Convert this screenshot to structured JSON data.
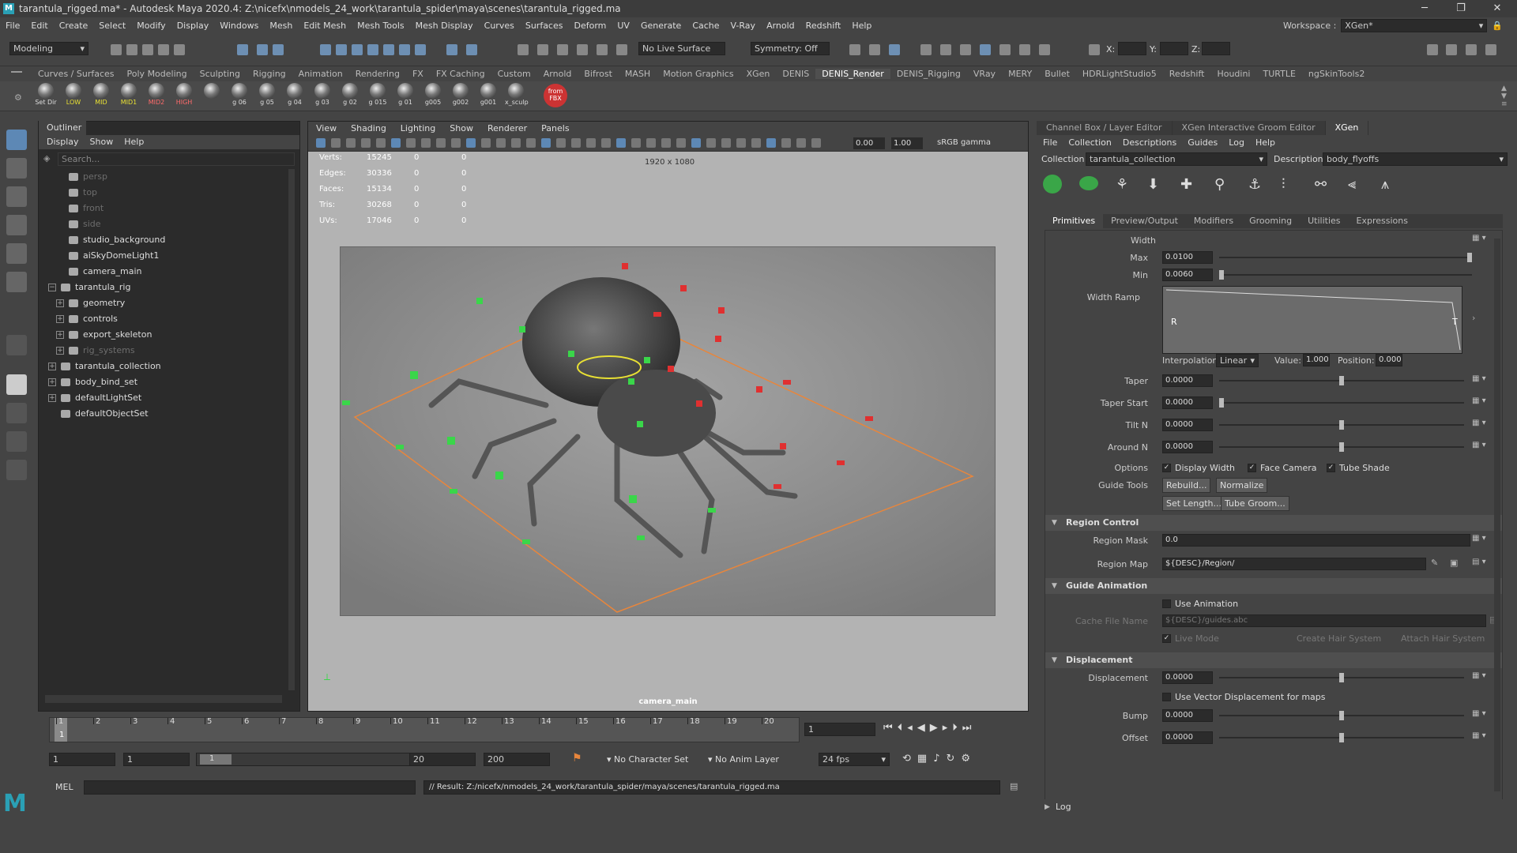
{
  "window": {
    "title": "tarantula_rigged.ma* - Autodesk Maya 2020.4: Z:\\nicefx\\nmodels_24_work\\tarantula_spider\\maya\\scenes\\tarantula_rigged.ma",
    "minimize": "─",
    "maximize": "❐",
    "close": "✕"
  },
  "menubar": {
    "items": [
      "File",
      "Edit",
      "Create",
      "Select",
      "Modify",
      "Display",
      "Windows",
      "Mesh",
      "Edit Mesh",
      "Mesh Tools",
      "Mesh Display",
      "Curves",
      "Surfaces",
      "Deform",
      "UV",
      "Generate",
      "Cache",
      "V-Ray",
      "Arnold",
      "Redshift",
      "Help"
    ],
    "workspace_label": "Workspace :",
    "workspace_value": "XGen*"
  },
  "statusline": {
    "mode": "Modeling",
    "live_surface": "No Live Surface",
    "symmetry": "Symmetry: Off",
    "x_label": "X:",
    "y_label": "Y:",
    "z_label": "Z:"
  },
  "shelf": {
    "tabs": [
      "Curves / Surfaces",
      "Poly Modeling",
      "Sculpting",
      "Rigging",
      "Animation",
      "Rendering",
      "FX",
      "FX Caching",
      "Custom",
      "Arnold",
      "Bifrost",
      "MASH",
      "Motion Graphics",
      "XGen",
      "DENIS",
      "DENIS_Render",
      "DENIS_Rigging",
      "VRay",
      "MERY",
      "Bullet",
      "HDRLightStudio5",
      "Redshift",
      "Houdini",
      "TURTLE",
      "ngSkinTools2"
    ],
    "active_tab": "DENIS_Render",
    "buttons": [
      "Set Dir",
      "LOW",
      "MID",
      "MID1",
      "MID2",
      "HIGH",
      "",
      "g 06",
      "g 05",
      "g 04",
      "g 03",
      "g 02",
      "g 015",
      "g 01",
      "g005",
      "g002",
      "g001",
      "x_sculp",
      ""
    ],
    "fbx_label": "from FBX"
  },
  "outliner": {
    "title": "Outliner",
    "menu": [
      "Display",
      "Show",
      "Help"
    ],
    "search_placeholder": "Search...",
    "items": [
      {
        "label": "persp",
        "indent": 1,
        "dim": true,
        "exp": ""
      },
      {
        "label": "top",
        "indent": 1,
        "dim": true,
        "exp": ""
      },
      {
        "label": "front",
        "indent": 1,
        "dim": true,
        "exp": ""
      },
      {
        "label": "side",
        "indent": 1,
        "dim": true,
        "exp": ""
      },
      {
        "label": "studio_background",
        "indent": 1,
        "dim": false,
        "exp": ""
      },
      {
        "label": "aiSkyDomeLight1",
        "indent": 1,
        "dim": false,
        "exp": ""
      },
      {
        "label": "camera_main",
        "indent": 1,
        "dim": false,
        "exp": ""
      },
      {
        "label": "tarantula_rig",
        "indent": 0,
        "dim": false,
        "exp": "−"
      },
      {
        "label": "geometry",
        "indent": 1,
        "dim": false,
        "exp": "+"
      },
      {
        "label": "controls",
        "indent": 1,
        "dim": false,
        "exp": "+"
      },
      {
        "label": "export_skeleton",
        "indent": 1,
        "dim": false,
        "exp": "+"
      },
      {
        "label": "rig_systems",
        "indent": 1,
        "dim": true,
        "exp": "+"
      },
      {
        "label": "tarantula_collection",
        "indent": 0,
        "dim": false,
        "exp": "+"
      },
      {
        "label": "body_bind_set",
        "indent": 0,
        "dim": false,
        "exp": "+"
      },
      {
        "label": "defaultLightSet",
        "indent": 0,
        "dim": false,
        "exp": "+"
      },
      {
        "label": "defaultObjectSet",
        "indent": 0,
        "dim": false,
        "exp": ""
      }
    ]
  },
  "viewport": {
    "menu": [
      "View",
      "Shading",
      "Lighting",
      "Show",
      "Renderer",
      "Panels"
    ],
    "field1": "0.00",
    "field2": "1.00",
    "colorspace": "sRGB gamma",
    "hud": [
      {
        "label": "Verts:",
        "v1": "15245",
        "v2": "0",
        "v3": "0"
      },
      {
        "label": "Edges:",
        "v1": "30336",
        "v2": "0",
        "v3": "0"
      },
      {
        "label": "Faces:",
        "v1": "15134",
        "v2": "0",
        "v3": "0"
      },
      {
        "label": "Tris:",
        "v1": "30268",
        "v2": "0",
        "v3": "0"
      },
      {
        "label": "UVs:",
        "v1": "17046",
        "v2": "0",
        "v3": "0"
      }
    ],
    "resolution": "1920 x 1080",
    "camera": "camera_main"
  },
  "rpanel": {
    "tabs": [
      "Channel Box / Layer Editor",
      "XGen Interactive Groom Editor",
      "XGen"
    ],
    "active_tab": "XGen",
    "menu": [
      "File",
      "Collection",
      "Descriptions",
      "Guides",
      "Log",
      "Help"
    ],
    "collection_label": "Collection",
    "collection_value": "tarantula_collection",
    "description_label": "Description",
    "description_value": "body_flyoffs",
    "subtabs": [
      "Primitives",
      "Preview/Output",
      "Modifiers",
      "Grooming",
      "Utilities",
      "Expressions"
    ],
    "active_subtab": "Primitives",
    "width_label": "Width",
    "max_label": "Max",
    "max_value": "0.0100",
    "min_label": "Min",
    "min_value": "0.0060",
    "ramp_label": "Width Ramp",
    "ramp_r": "R",
    "ramp_t": "T",
    "interp_label": "Interpolation:",
    "interp_value": "Linear",
    "value_label": "Value:",
    "value_value": "1.000",
    "position_label": "Position:",
    "position_value": "0.000",
    "taper_label": "Taper",
    "taper_value": "0.0000",
    "taper_start_label": "Taper Start",
    "taper_start_value": "0.0000",
    "tilt_label": "Tilt N",
    "tilt_value": "0.0000",
    "around_label": "Around N",
    "around_value": "0.0000",
    "options_label": "Options",
    "opt_display_width": "Display Width",
    "opt_face_camera": "Face Camera",
    "opt_tube_shade": "Tube Shade",
    "guide_tools_label": "Guide Tools",
    "btn_rebuild": "Rebuild...",
    "btn_normalize": "Normalize",
    "btn_set_length": "Set Length...",
    "btn_tube_groom": "Tube Groom...",
    "sec_region": "Region Control",
    "region_mask_label": "Region Mask",
    "region_mask_value": "0.0",
    "region_map_label": "Region Map",
    "region_map_value": "${DESC}/Region/",
    "sec_guide_anim": "Guide Animation",
    "use_animation": "Use Animation",
    "cache_label": "Cache File Name",
    "cache_value": "${DESC}/guides.abc",
    "live_mode": "Live Mode",
    "create_hair": "Create Hair System",
    "attach_hair": "Attach Hair System",
    "sec_displacement": "Displacement",
    "disp_label": "Displacement",
    "disp_value": "0.0000",
    "use_vector": "Use Vector Displacement for maps",
    "bump_label": "Bump",
    "bump_value": "0.0000",
    "offset_label": "Offset",
    "offset_value": "0.0000",
    "log_label": "Log"
  },
  "timeline": {
    "ticks": [
      "1",
      "2",
      "3",
      "4",
      "5",
      "6",
      "7",
      "8",
      "9",
      "10",
      "11",
      "12",
      "13",
      "14",
      "15",
      "16",
      "17",
      "18",
      "19",
      "20"
    ],
    "current_frame": "1",
    "current_field": "1"
  },
  "range": {
    "start": "1",
    "anim_start": "1",
    "slider_label": "1",
    "end": "20",
    "anim_end": "200",
    "char_set": "No Character Set",
    "anim_layer": "No Anim Layer",
    "fps": "24 fps"
  },
  "cmd": {
    "lang": "MEL",
    "result": "// Result: Z:/nicefx/nmodels_24_work/tarantula_spider/maya/scenes/tarantula_rigged.ma"
  },
  "colors": {
    "accent": "#5d88b5",
    "selection_orange": "#e8863c",
    "control_green": "#3ad64a",
    "control_red": "#e03030"
  }
}
